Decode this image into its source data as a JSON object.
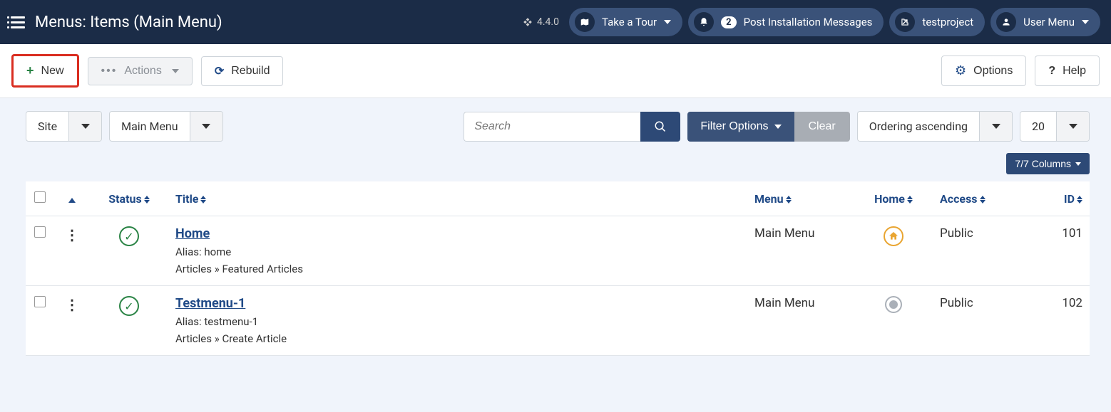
{
  "header": {
    "page_title": "Menus: Items (Main Menu)",
    "version": "4.4.0",
    "tour_label": "Take a Tour",
    "notif_count": "2",
    "messages_label": "Post Installation Messages",
    "project_label": "testproject",
    "user_menu_label": "User Menu"
  },
  "toolbar": {
    "new_label": "New",
    "actions_label": "Actions",
    "rebuild_label": "Rebuild",
    "options_label": "Options",
    "help_label": "Help"
  },
  "filters": {
    "client": "Site",
    "menu": "Main Menu",
    "search_placeholder": "Search",
    "filter_options_label": "Filter Options",
    "clear_label": "Clear",
    "ordering_label": "Ordering ascending",
    "limit_label": "20",
    "columns_label": "7/7 Columns"
  },
  "columns": {
    "status": "Status",
    "title": "Title",
    "menu": "Menu",
    "home": "Home",
    "access": "Access",
    "id": "ID"
  },
  "rows": [
    {
      "title": "Home",
      "alias_label": "Alias: home",
      "path": "Articles » Featured Articles",
      "menu": "Main Menu",
      "is_home": true,
      "access": "Public",
      "id": "101"
    },
    {
      "title": "Testmenu-1",
      "alias_label": "Alias: testmenu-1",
      "path": "Articles » Create Article",
      "menu": "Main Menu",
      "is_home": false,
      "access": "Public",
      "id": "102"
    }
  ]
}
